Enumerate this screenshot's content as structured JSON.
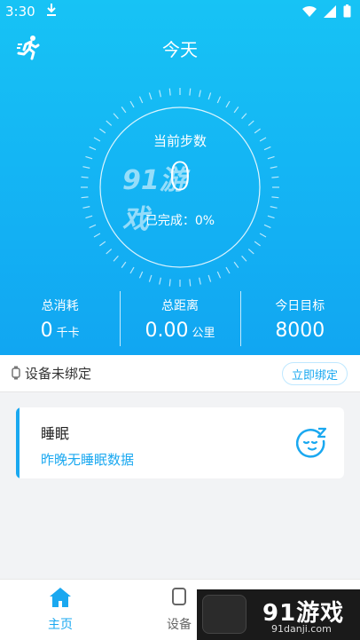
{
  "status": {
    "time": "3:30",
    "download_icon": "download-arrow-icon"
  },
  "header": {
    "title": "今天"
  },
  "steps": {
    "title": "当前步数",
    "value": "0",
    "complete": "已完成：0%"
  },
  "stats": [
    {
      "label": "总消耗",
      "value": "0",
      "unit": "千卡"
    },
    {
      "label": "总距离",
      "value": "0.00",
      "unit": "公里"
    },
    {
      "label": "今日目标",
      "value": "8000",
      "unit": ""
    }
  ],
  "device": {
    "text": "设备未绑定",
    "bind_label": "立即绑定"
  },
  "sleep": {
    "title": "睡眠",
    "subtitle": "昨晚无睡眠数据"
  },
  "nav": {
    "home_label": "主页",
    "device_label": "设备"
  },
  "watermark": {
    "logo": "91游戏",
    "url": "91danji.com",
    "center_logo": "91游戏"
  },
  "colors": {
    "accent": "#1aa8f0",
    "hero_top": "#17c3f5",
    "hero_bottom": "#11a6f2"
  }
}
